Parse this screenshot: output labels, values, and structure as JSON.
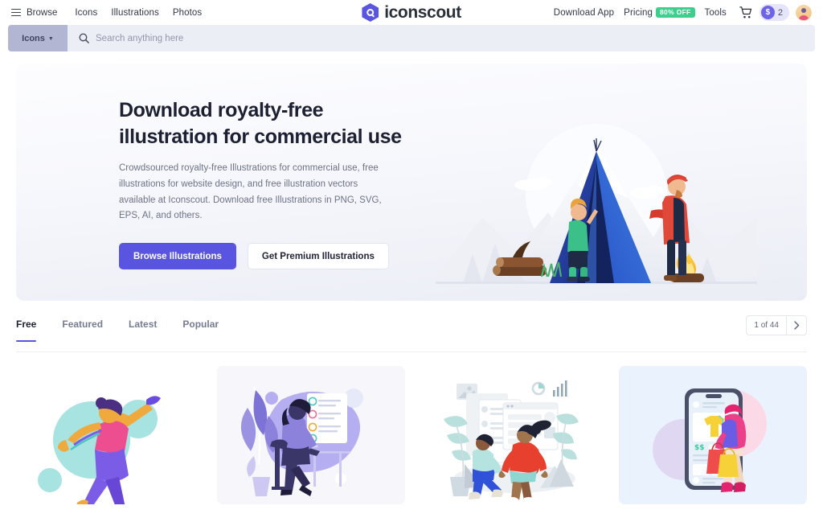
{
  "header": {
    "browse_label": "Browse",
    "menu_icon": "hamburger-icon",
    "links": [
      {
        "label": "Icons"
      },
      {
        "label": "Illustrations"
      },
      {
        "label": "Photos"
      }
    ],
    "brand_name": "iconscout",
    "logo_icon": "iconscout-logo-icon",
    "right_links": [
      {
        "label": "Download App"
      },
      {
        "label": "Tools"
      }
    ],
    "pricing_label": "Pricing",
    "pricing_badge": "80% OFF",
    "cart_icon": "shopping-cart-icon",
    "coin_symbol": "$",
    "credits_count": "2",
    "avatar_icon": "user-avatar"
  },
  "search": {
    "category": "Icons",
    "caret_icon": "chevron-down-icon",
    "search_icon": "search-icon",
    "placeholder": "Search anything here",
    "value": ""
  },
  "hero": {
    "title_line1": "Download royalty-free",
    "title_line2": "illustration for commercial use",
    "description": "Crowdsourced royalty-free Illustrations for commercial use, free illustrations for website design, and free illustration vectors available at Iconscout. Download free Illustrations in PNG, SVG, EPS, AI, and others.",
    "primary_button": "Browse Illustrations",
    "secondary_button": "Get Premium Illustrations",
    "artwork_name": "camping-tent-family-illustration"
  },
  "tabs": {
    "items": [
      {
        "label": "Free",
        "active": true
      },
      {
        "label": "Featured",
        "active": false
      },
      {
        "label": "Latest",
        "active": false
      },
      {
        "label": "Popular",
        "active": false
      }
    ]
  },
  "pagination": {
    "status": "1 of 44",
    "next_icon": "chevron-right-icon"
  },
  "cards": [
    {
      "name": "woman-jumping-celebration-illustration",
      "bg": "#ffffff"
    },
    {
      "name": "woman-working-on-laptop-checklist-illustration",
      "bg": "#f6f6fb"
    },
    {
      "name": "people-dashboard-interface-illustration",
      "bg": "#ffffff"
    },
    {
      "name": "online-shopping-mobile-illustration",
      "bg": "#eaf3fd"
    }
  ],
  "colors": {
    "brand_purple": "#5a55e0",
    "badge_green": "#3ecf8e",
    "search_bg": "#eceef5",
    "category_bg": "#b3b6d2",
    "text_dark": "#1d2033",
    "text_muted": "#6e7287"
  }
}
